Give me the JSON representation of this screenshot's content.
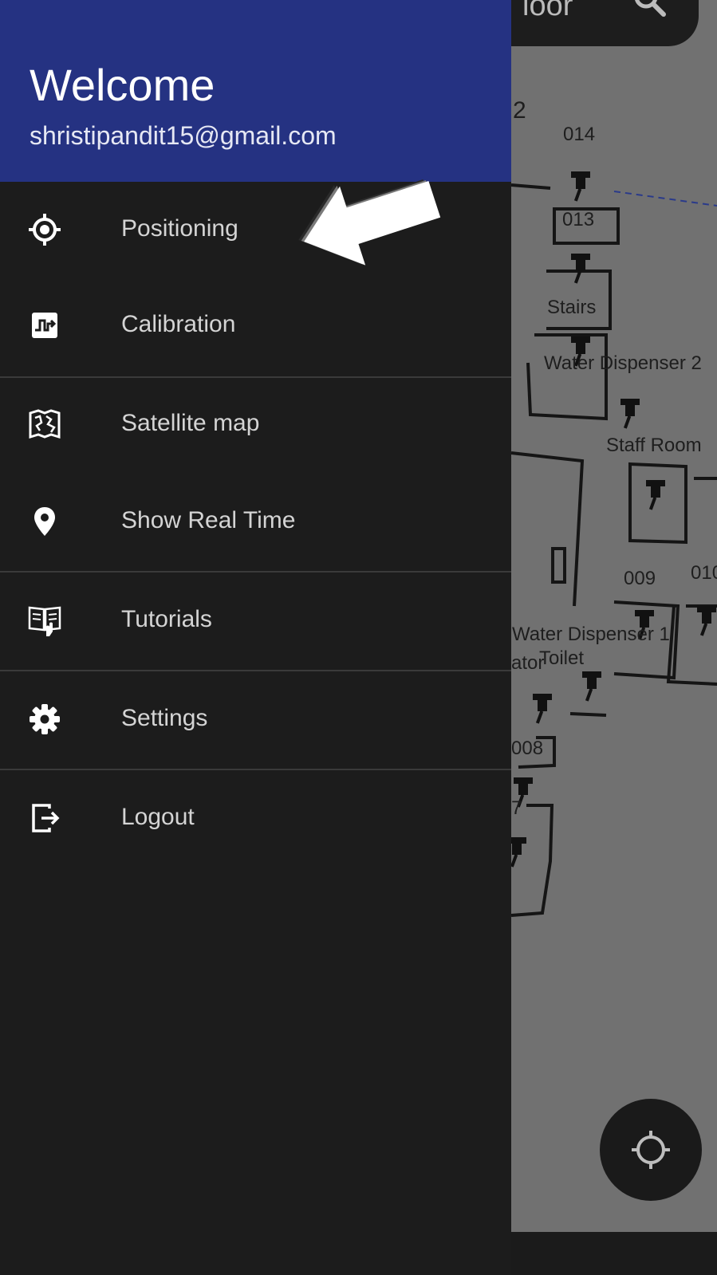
{
  "header": {
    "title": "Welcome",
    "email": "shristipandit15@gmail.com"
  },
  "menu": [
    {
      "label": "Positioning",
      "icon": "crosshair-icon"
    },
    {
      "label": "Calibration",
      "icon": "calibration-icon"
    },
    {
      "label": "Satellite map",
      "icon": "map-icon"
    },
    {
      "label": "Show Real Time",
      "icon": "location-pin-icon"
    },
    {
      "label": "Tutorials",
      "icon": "tutorial-book-icon"
    },
    {
      "label": "Settings",
      "icon": "gear-icon"
    },
    {
      "label": "Logout",
      "icon": "logout-icon"
    }
  ],
  "map": {
    "topbar_text": "loor",
    "labels": {
      "room_2": "2",
      "room_014": "014",
      "room_013": "013",
      "stairs": "Stairs",
      "water_dispenser_2": "Water Dispenser 2",
      "staff_room": "Staff Room",
      "room_009": "009",
      "room_010": "010",
      "water_dispenser_1": "Water Dispenser 1",
      "toilet": "Toilet",
      "elevator": "ator",
      "room_008": "008",
      "room_007": "7"
    }
  },
  "colors": {
    "header_bg": "#253282",
    "drawer_bg": "#1c1c1c",
    "scrim_map": "#717171"
  }
}
